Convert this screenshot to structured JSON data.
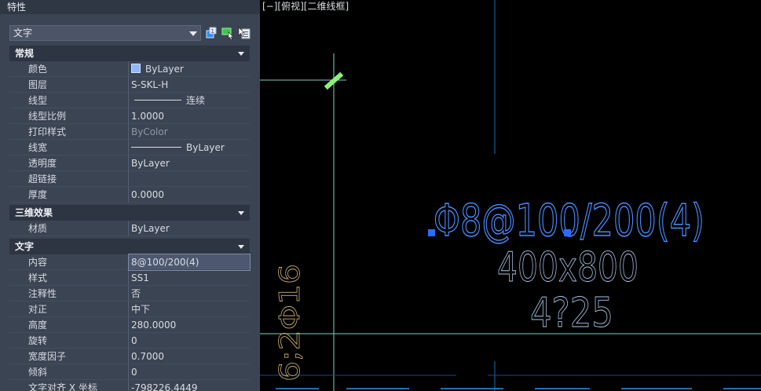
{
  "palette": {
    "title": "特性",
    "object_type": "文字",
    "toolbar": {
      "icons": [
        "toggle-pickadd-icon",
        "select-objects-icon",
        "quick-select-icon"
      ]
    },
    "sections": [
      {
        "title": "常规",
        "rows": [
          {
            "name": "颜色",
            "value": "ByLayer",
            "swatch": "#8fb8ff"
          },
          {
            "name": "图层",
            "value": "S-SKL-H"
          },
          {
            "name": "线型",
            "value": "连续",
            "linetype": true
          },
          {
            "name": "线型比例",
            "value": "1.0000"
          },
          {
            "name": "打印样式",
            "value": "ByColor",
            "dim": true
          },
          {
            "name": "线宽",
            "value": "ByLayer",
            "linetype": true
          },
          {
            "name": "透明度",
            "value": "ByLayer"
          },
          {
            "name": "超链接",
            "value": ""
          },
          {
            "name": "厚度",
            "value": "0.0000"
          }
        ]
      },
      {
        "title": "三维效果",
        "rows": [
          {
            "name": "材质",
            "value": "ByLayer"
          }
        ]
      },
      {
        "title": "文字",
        "rows": [
          {
            "name": "内容",
            "value": "8@100/200(4)",
            "selected": true
          },
          {
            "name": "样式",
            "value": "SS1"
          },
          {
            "name": "注释性",
            "value": "否"
          },
          {
            "name": "对正",
            "value": "中下"
          },
          {
            "name": "高度",
            "value": "280.0000"
          },
          {
            "name": "旋转",
            "value": "0"
          },
          {
            "name": "宽度因子",
            "value": "0.7000"
          },
          {
            "name": "倾斜",
            "value": "0"
          },
          {
            "name": "文字对齐 X 坐标",
            "value": "-798226.4449"
          }
        ]
      }
    ]
  },
  "viewport": {
    "label": "[−][俯视][二维线框]",
    "texts": {
      "stirrup": "Φ8@100/200(4)",
      "section_size": "400x800",
      "bottom_bars": "4?25",
      "side_bars": "6;2Φ16"
    },
    "colors": {
      "selected_text": "#4a8fff",
      "beam_text": "#a9c9ea",
      "side_text": "#c8b070",
      "axis_line": "#7ecfc0",
      "beam_edge": "#1f6fb0",
      "grip": "#2a6cff",
      "marker": "#8cf07a"
    }
  }
}
